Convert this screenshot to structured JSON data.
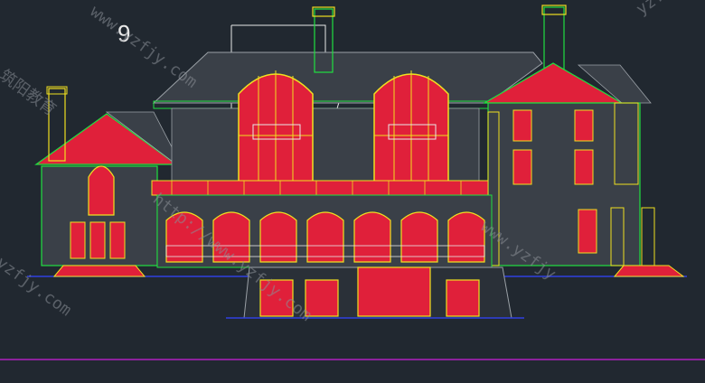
{
  "canvas": {
    "background": "#212830"
  },
  "drawing_marker": "9",
  "watermarks": [
    "www.yzfjy.com",
    "yzfjy.com",
    "http://www.yzfjy.com",
    "筑阳教育",
    "yzfjy.com",
    "www.yzfjy"
  ],
  "colors": {
    "red": "#e0203a",
    "yellow": "#f0e020",
    "green": "#20e040",
    "cyan": "#20d8e0",
    "white": "#e8e8e8",
    "gray": "#9aa0a6",
    "magenta": "#b020c0",
    "blue": "#3040e0"
  }
}
